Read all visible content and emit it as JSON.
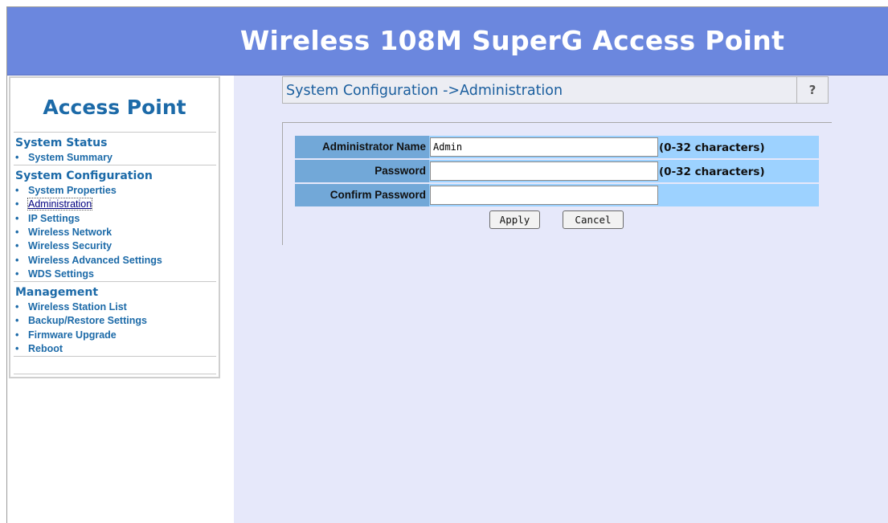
{
  "header": {
    "title": "Wireless 108M SuperG Access Point"
  },
  "sidebar": {
    "logo": "Access Point",
    "sections": [
      {
        "title": "System Status",
        "items": [
          "System Summary"
        ]
      },
      {
        "title": "System Configuration",
        "items": [
          "System Properties",
          "Administration",
          "IP Settings",
          "Wireless Network",
          "Wireless Security",
          "Wireless Advanced Settings",
          "WDS Settings"
        ]
      },
      {
        "title": "Management",
        "items": [
          "Wireless Station List",
          "Backup/Restore Settings",
          "Firmware Upgrade",
          "Reboot"
        ]
      }
    ],
    "bullet": "•",
    "active_item": "Administration"
  },
  "page": {
    "title": "System Configuration ->Administration",
    "help_label": "?"
  },
  "form": {
    "admin_name": {
      "label": "Administrator Name",
      "value": "Admin",
      "hint": "(0-32 characters)"
    },
    "password": {
      "label": "Password",
      "value": "",
      "hint": "(0-32 characters)"
    },
    "confirm_password": {
      "label": "Confirm Password",
      "value": ""
    },
    "apply_label": "Apply",
    "cancel_label": "Cancel"
  },
  "colors": {
    "header_bg": "#6b87de",
    "content_bg": "#e6e8fa",
    "label_cell": "#72a8d8",
    "row_bg": "#9dd2ff",
    "link": "#1c6aa8"
  }
}
